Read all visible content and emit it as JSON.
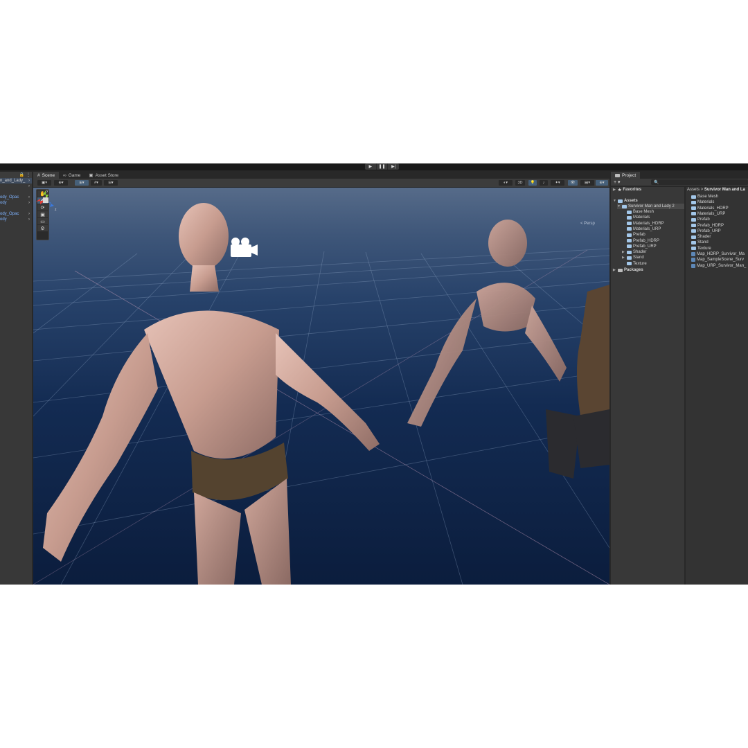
{
  "toolbar": {
    "play": "▶",
    "pause": "❚❚",
    "step": "▶|"
  },
  "hierarchy": {
    "items": [
      {
        "label": "n_and_Lady_",
        "style": "sel"
      },
      {
        "label": "",
        "style": ""
      },
      {
        "label": "",
        "style": "gap"
      },
      {
        "label": "ody_Opac",
        "style": "blue"
      },
      {
        "label": "ody",
        "style": "blue"
      },
      {
        "label": "",
        "style": "gap"
      },
      {
        "label": "ody_Opac",
        "style": "blue"
      },
      {
        "label": "ody",
        "style": "blue"
      }
    ]
  },
  "scene_tabs": [
    {
      "label": "Scene",
      "icon": "#"
    },
    {
      "label": "Game",
      "icon": "∞"
    },
    {
      "label": "Asset Store",
      "icon": "▣"
    }
  ],
  "scene_toolbar": {
    "mode_2d3d": "3D"
  },
  "viewport": {
    "persp_label": "< Persp",
    "gizmo_axes": {
      "y": "y",
      "z": "z"
    },
    "tools": [
      "✋",
      "✥",
      "⟳",
      "▣",
      "▭",
      "⚙"
    ]
  },
  "project": {
    "tab_label": "Project",
    "add_label": "+ ▾",
    "search_placeholder": "🔍",
    "favorites_label": "Favorites",
    "assets_label": "Assets",
    "root_folder": "Survivor Man and Lady 2",
    "subfolders": [
      "Base Mesh",
      "Materials",
      "Materials_HDRP",
      "Materials_URP",
      "Prefab",
      "Prefab_HDRP",
      "Prefab_URP",
      "Shader",
      "Stand",
      "Texture"
    ],
    "packages_label": "Packages",
    "breadcrumb_root": "Assets",
    "breadcrumb_sep": ">",
    "breadcrumb_current": "Survivor Man and La",
    "files": [
      {
        "label": "Base Mesh",
        "kind": "folder"
      },
      {
        "label": "Materials",
        "kind": "folder"
      },
      {
        "label": "Materials_HDRP",
        "kind": "folder"
      },
      {
        "label": "Materials_URP",
        "kind": "folder"
      },
      {
        "label": "Prefab",
        "kind": "folder"
      },
      {
        "label": "Prefab_HDRP",
        "kind": "folder"
      },
      {
        "label": "Prefab_URP",
        "kind": "folder"
      },
      {
        "label": "Shader",
        "kind": "folder"
      },
      {
        "label": "Stand",
        "kind": "folder"
      },
      {
        "label": "Texture",
        "kind": "folder"
      },
      {
        "label": "Map_HDRP_Survivor_Ma",
        "kind": "scene"
      },
      {
        "label": "Map_SampleScene_Surv",
        "kind": "scene"
      },
      {
        "label": "Map_URP_Survivor_Man_",
        "kind": "scene"
      }
    ]
  },
  "colors": {
    "editor_bg": "#282828",
    "panel_bg": "#383838",
    "accent": "#46607a",
    "folder": "#a3c7e9"
  }
}
